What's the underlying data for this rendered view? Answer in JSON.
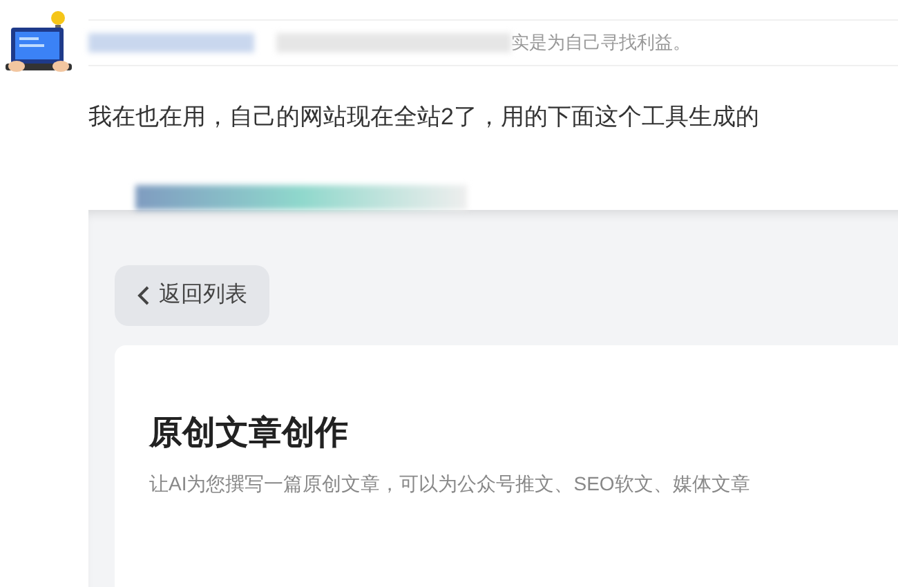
{
  "quote": {
    "text": "实是为自己寻找利益。"
  },
  "comment": {
    "text": "我在也在用，自己的网站现在全站2了，用的下面这个工具生成的"
  },
  "embedded_screenshot": {
    "back_button": {
      "label": "返回列表"
    },
    "title": "原创文章创作",
    "description": "让AI为您撰写一篇原创文章，可以为公众号推文、SEO软文、媒体文章"
  }
}
